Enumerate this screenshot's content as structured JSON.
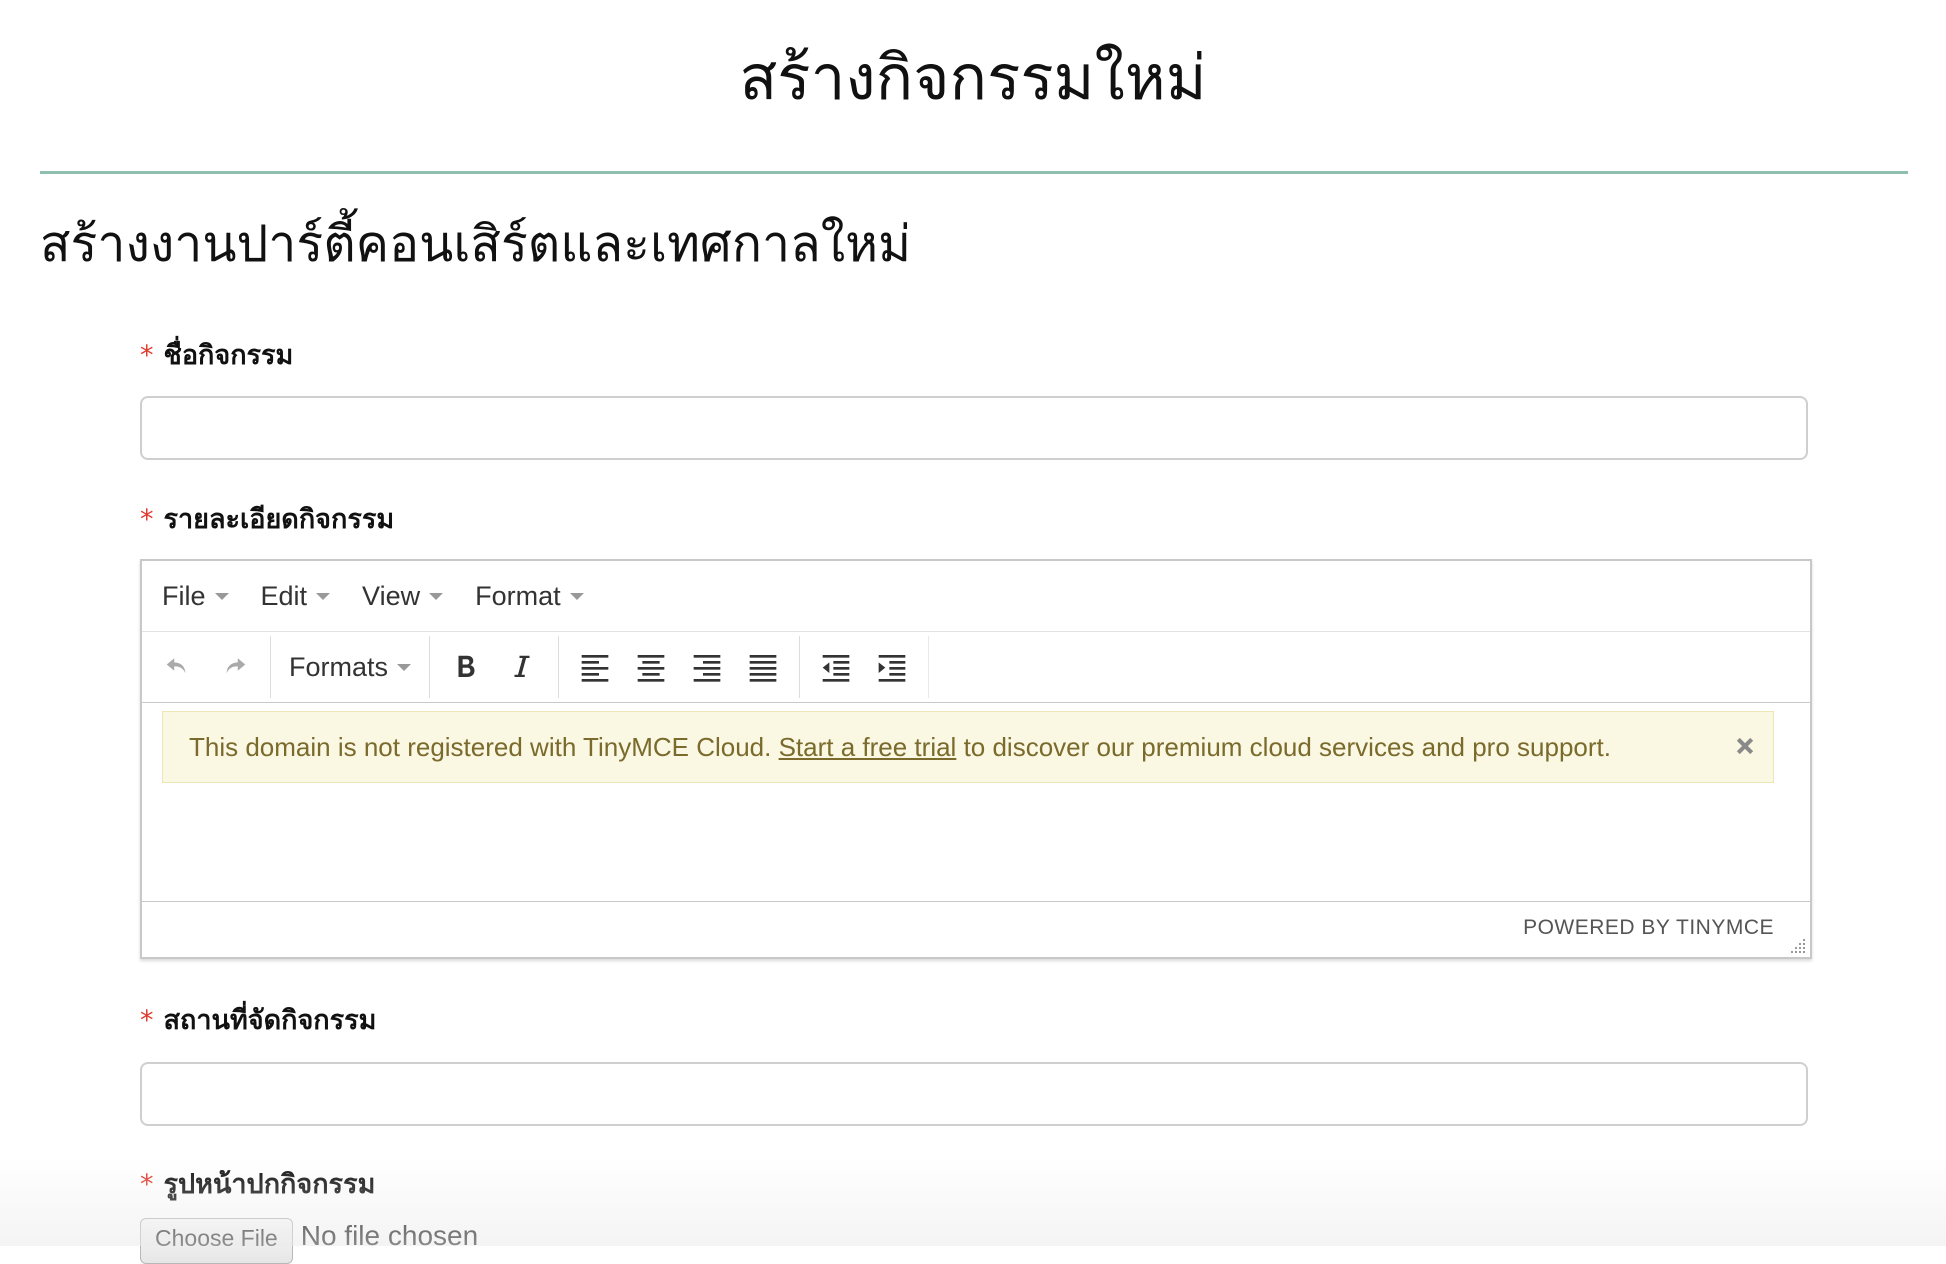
{
  "page": {
    "title": "สร้างกิจกรรมใหม่",
    "section_title": "สร้างงานปาร์ตี้คอนเสิร์ตและเทศกาลใหม่"
  },
  "colors": {
    "accent_rule": "#8fbfae",
    "required_asterisk": "#e03b2f",
    "notice_bg": "#faf7e2",
    "notice_text": "#7a6a2c"
  },
  "form": {
    "required_marker": "*",
    "event_name": {
      "label": "ชื่อกิจกรรม",
      "value": "",
      "placeholder": ""
    },
    "event_details": {
      "label": "รายละเอียดกิจกรรม"
    },
    "event_location": {
      "label": "สถานที่จัดกิจกรรม",
      "value": "",
      "placeholder": ""
    },
    "cover_image": {
      "label": "รูปหน้าปกกิจกรรม",
      "button_label": "Choose File",
      "status": "No file chosen"
    }
  },
  "editor": {
    "menubar": [
      {
        "label": "File"
      },
      {
        "label": "Edit"
      },
      {
        "label": "View"
      },
      {
        "label": "Format"
      }
    ],
    "toolbar": {
      "formats_label": "Formats",
      "buttons": [
        "undo-icon",
        "redo-icon",
        "bold-icon",
        "italic-icon",
        "align-left-icon",
        "align-center-icon",
        "align-right-icon",
        "align-justify-icon",
        "outdent-icon",
        "indent-icon"
      ]
    },
    "notice": {
      "text_before": "This domain is not registered with TinyMCE Cloud.",
      "link": "Start a free trial",
      "text_after": "to discover our premium cloud services and pro support."
    },
    "powered_by": "POWERED BY TINYMCE"
  }
}
